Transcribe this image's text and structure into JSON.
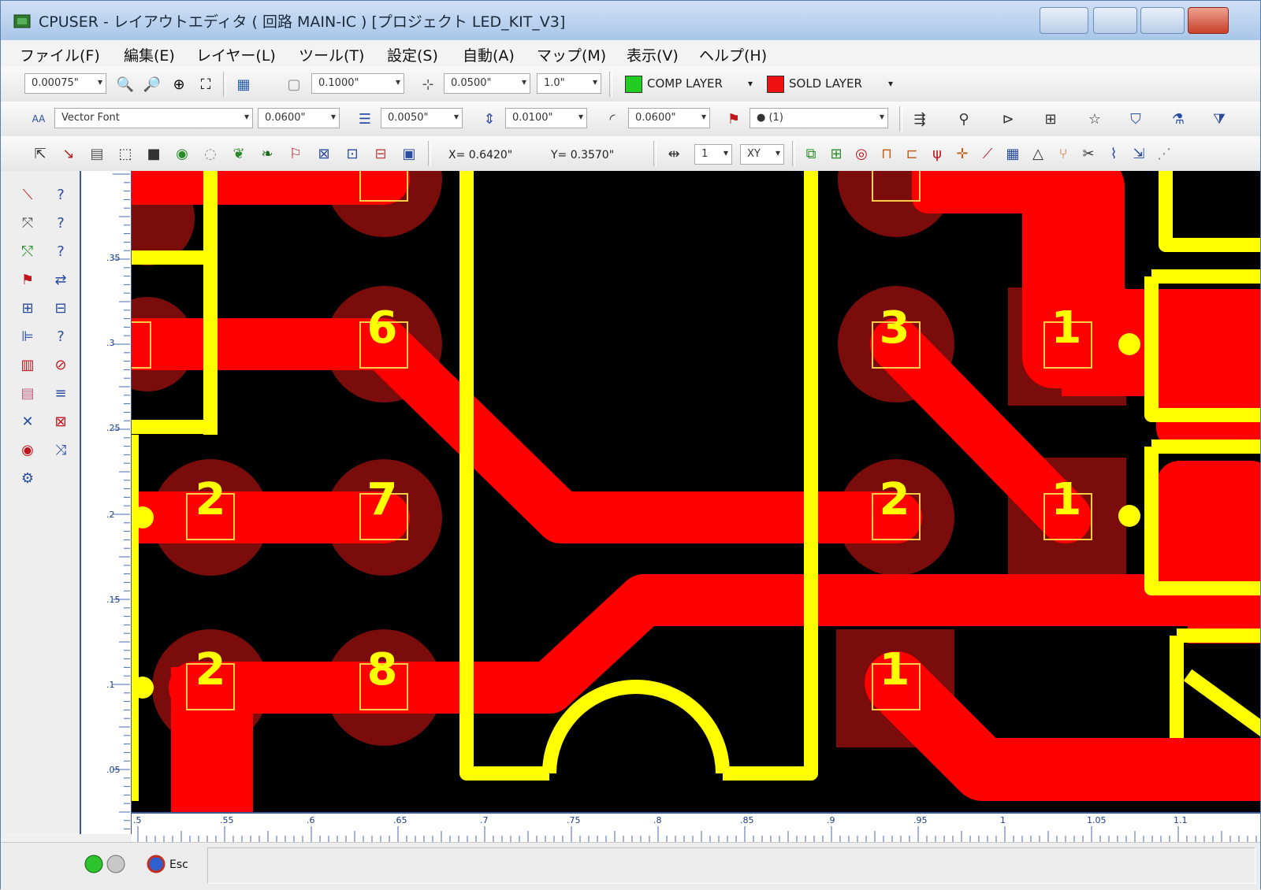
{
  "window": {
    "title": "CPUSER - レイアウトエディタ ( 回路 MAIN-IC ) [プロジェクト LED_KIT_V3]"
  },
  "menu": [
    {
      "label": "ファイル(F)"
    },
    {
      "label": "編集(E)"
    },
    {
      "label": "レイヤー(L)"
    },
    {
      "label": "ツール(T)"
    },
    {
      "label": "設定(S)"
    },
    {
      "label": "自動(A)"
    },
    {
      "label": "マップ(M)"
    },
    {
      "label": "表示(V)"
    },
    {
      "label": "ヘルプ(H)"
    }
  ],
  "toolbar1": {
    "zoom_step": "0.00075\"",
    "grid": "0.1000\"",
    "snap": "0.0500\"",
    "scale": "1.0\"",
    "comp_layer": "COMP LAYER",
    "sold_layer": "SOLD LAYER"
  },
  "toolbar2": {
    "font": "Vector Font",
    "text_size": "0.0600\"",
    "line_width": "0.0050\"",
    "spacing": "0.0100\"",
    "arc_size": "0.0600\"",
    "pad_type": "● (1)"
  },
  "toolbar3": {
    "x_readout": "X= 0.6420\"",
    "y_readout": "Y= 0.3570\"",
    "unit_count": "1",
    "axis_mode": "XY"
  },
  "vruler_labels": [
    ".35",
    ".3",
    ".25",
    ".2",
    ".15",
    ".1",
    ".05"
  ],
  "hruler_labels": [
    ".5",
    ".55",
    ".6",
    ".65",
    ".7",
    ".75",
    ".8",
    ".85",
    ".9",
    ".95",
    "1",
    "1.05",
    "1.1"
  ],
  "pads": [
    {
      "label": "6"
    },
    {
      "label": "7"
    },
    {
      "label": "8"
    },
    {
      "label": "2"
    },
    {
      "label": "2"
    },
    {
      "label": "3"
    },
    {
      "label": "2"
    },
    {
      "label": "1"
    },
    {
      "label": "1"
    },
    {
      "label": "1"
    }
  ],
  "status": {
    "text": "Esc"
  },
  "colors": {
    "copper": "#ff0000",
    "silkscreen": "#ffff00",
    "pad_ring": "#7a0c0c",
    "board": "#000000",
    "comp_layer_swatch": "#22cc22",
    "sold_layer_swatch": "#ee1111"
  }
}
